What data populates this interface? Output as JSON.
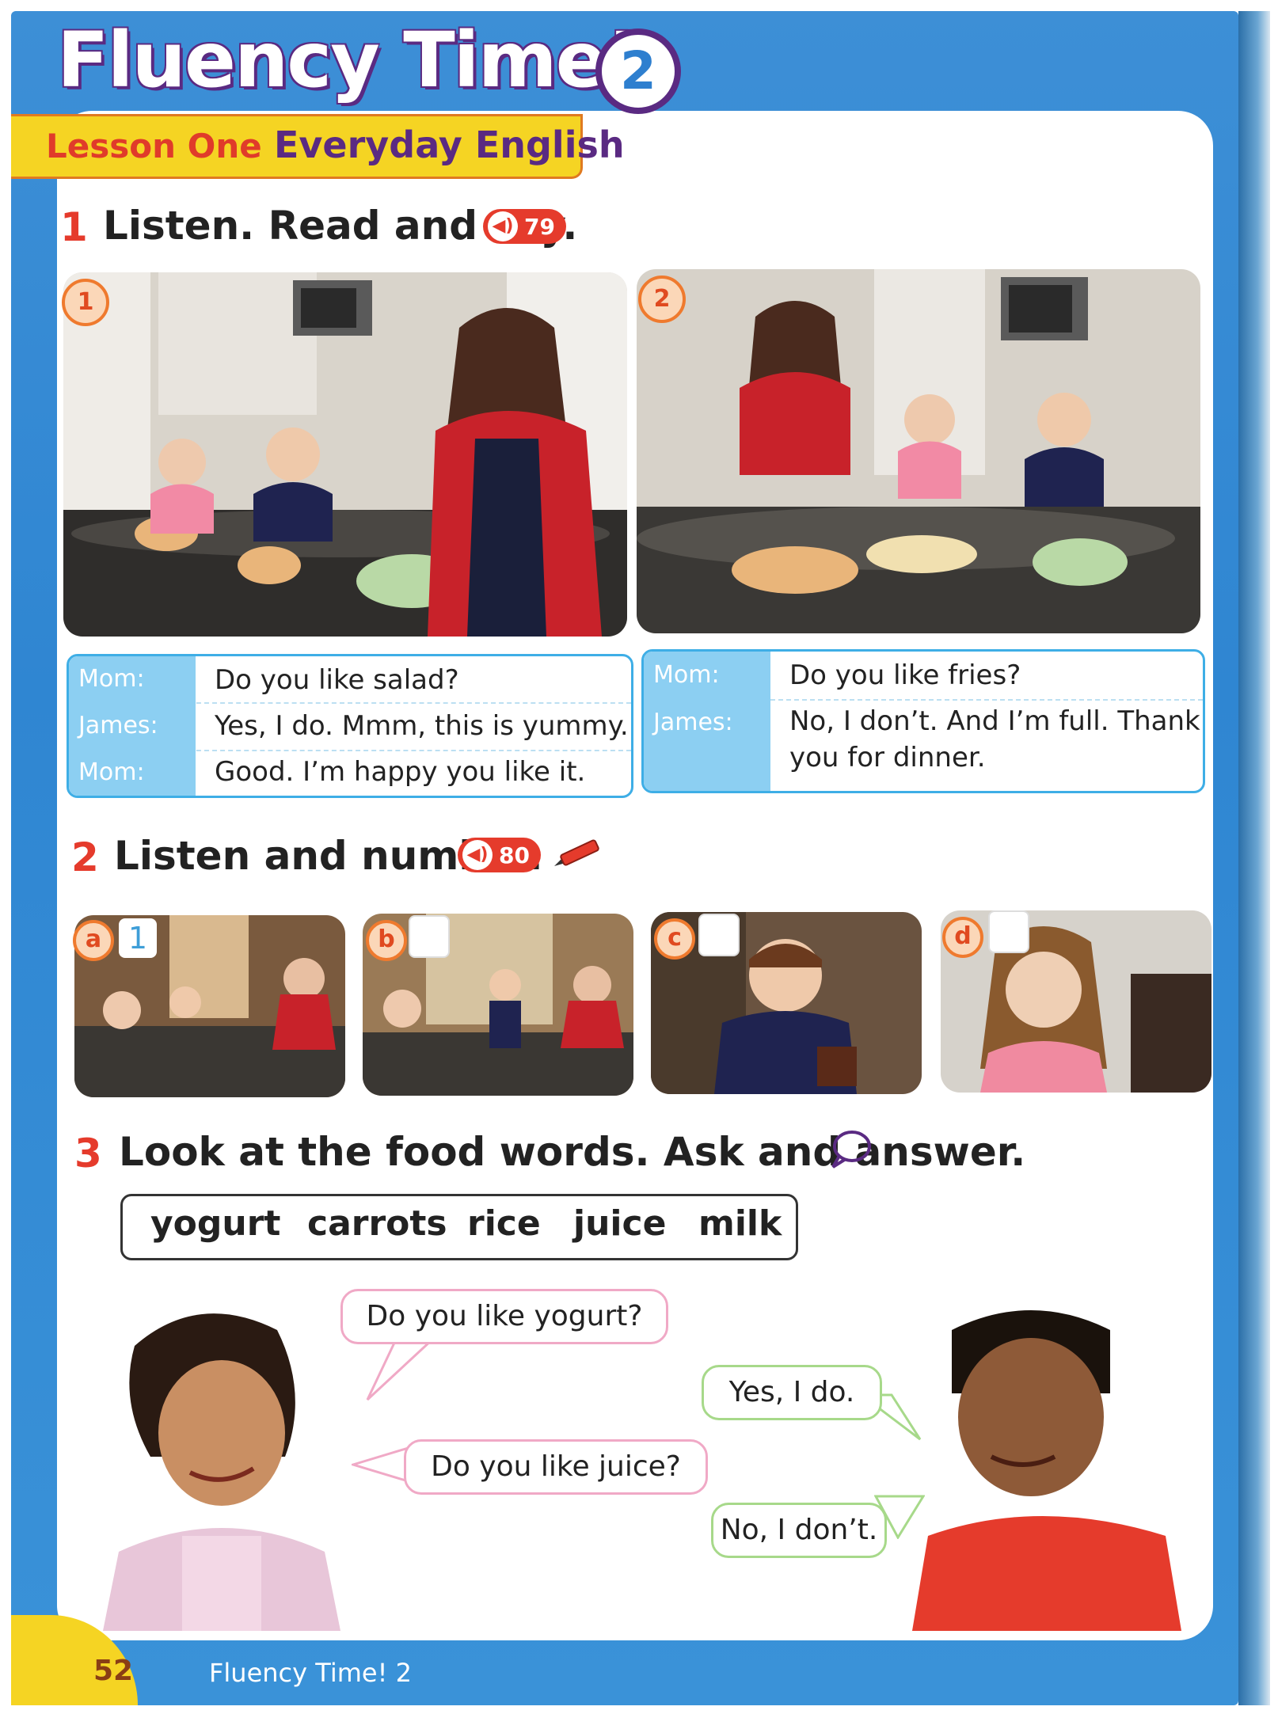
{
  "header": {
    "title": "Fluency Time!",
    "title_number": "2",
    "lesson_label": "Lesson One",
    "lesson_subtitle": "Everyday English"
  },
  "section1": {
    "number": "1",
    "title": "Listen. Read and say.",
    "audio_track": "79",
    "scenes": [
      {
        "number": "1",
        "dialogue": [
          {
            "speaker": "Mom:",
            "line": "Do you like salad?"
          },
          {
            "speaker": "James:",
            "line": "Yes, I do. Mmm, this is yummy."
          },
          {
            "speaker": "Mom:",
            "line": "Good. I’m happy you like it."
          }
        ]
      },
      {
        "number": "2",
        "dialogue": [
          {
            "speaker": "Mom:",
            "line": "Do you like fries?"
          },
          {
            "speaker": "James:",
            "line": "No, I don’t. And I’m full. Thank",
            "line2": "you for dinner."
          }
        ]
      }
    ]
  },
  "section2": {
    "number": "2",
    "title": "Listen and number.",
    "audio_track": "80",
    "icon": "pencil-icon",
    "items": [
      {
        "letter": "a",
        "answer": "1"
      },
      {
        "letter": "b",
        "answer": ""
      },
      {
        "letter": "c",
        "answer": ""
      },
      {
        "letter": "d",
        "answer": ""
      }
    ]
  },
  "section3": {
    "number": "3",
    "title": "Look at the food words. Ask and answer.",
    "icon": "speech-bubble-icon",
    "words": [
      "yogurt",
      "carrots",
      "rice",
      "juice",
      "milk"
    ],
    "bubbles": [
      {
        "text": "Do you like yogurt?"
      },
      {
        "text": "Yes, I do."
      },
      {
        "text": "Do you like juice?"
      },
      {
        "text": "No, I don’t."
      }
    ]
  },
  "footer": {
    "page_number": "52",
    "text": "Fluency Time! 2"
  },
  "colors": {
    "frame_blue": "#2f86d2",
    "accent_red": "#e53b2c",
    "purple": "#5a2a82",
    "yellow": "#f5d423",
    "dialogue_blue": "#8ccff2"
  }
}
